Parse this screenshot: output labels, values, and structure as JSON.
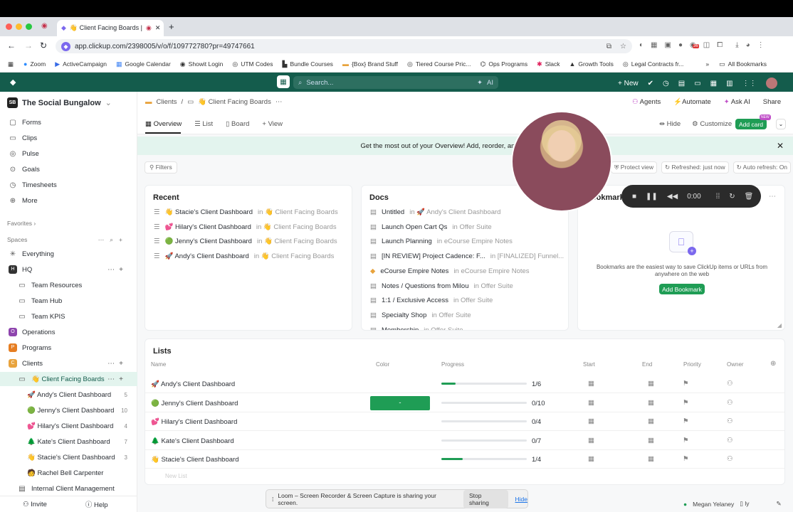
{
  "browser": {
    "tab_title": "👋 Client Facing Boards |",
    "url": "app.clickup.com/2398005/v/o/f/109772780?pr=49747661",
    "bookmarks": [
      "Zoom",
      "ActiveCampaign",
      "Google Calendar",
      "Showit Login",
      "UTM Codes",
      "Bundle Courses",
      "{Box} Brand Stuff",
      "Tiered Course Pric...",
      "Ops Programs",
      "Slack",
      "Growth Tools",
      "Legal Contracts fr..."
    ],
    "all_bookmarks": "All Bookmarks",
    "badge": "36"
  },
  "topbar": {
    "search_placeholder": "Search...",
    "ai_label": "AI",
    "new_label": "New"
  },
  "workspace": {
    "name": "The Social Bungalow",
    "initials": "SB"
  },
  "sidebar": {
    "items": [
      {
        "label": "Forms",
        "icon": "▢"
      },
      {
        "label": "Clips",
        "icon": "▭"
      },
      {
        "label": "Pulse",
        "icon": "◎"
      },
      {
        "label": "Goals",
        "icon": "⊙"
      },
      {
        "label": "Timesheets",
        "icon": "◷"
      },
      {
        "label": "More",
        "icon": "⊕"
      }
    ],
    "favorites": "Favorites",
    "spaces": "Spaces",
    "space_items": [
      {
        "label": "Everything",
        "icon": "✳",
        "indent": 0
      },
      {
        "label": "HQ",
        "icon": "H",
        "indent": 0
      },
      {
        "label": "Team Resources",
        "icon": "▭",
        "indent": 1
      },
      {
        "label": "Team Hub",
        "icon": "▭",
        "indent": 1
      },
      {
        "label": "Team KPIS",
        "icon": "▭",
        "indent": 1
      },
      {
        "label": "Operations",
        "icon": "O",
        "indent": 0
      },
      {
        "label": "Programs",
        "icon": "P",
        "indent": 0
      },
      {
        "label": "Clients",
        "icon": "C",
        "indent": 0
      },
      {
        "label": "👋 Client Facing Boards",
        "icon": "▭",
        "indent": 1
      },
      {
        "label": "🚀 Andy's Client Dashboard",
        "icon": "",
        "indent": 2,
        "count": "5"
      },
      {
        "label": "🟢 Jenny's Client Dashboard",
        "icon": "",
        "indent": 2,
        "count": "10"
      },
      {
        "label": "💕 Hilary's Client Dashboard",
        "icon": "",
        "indent": 2,
        "count": "4"
      },
      {
        "label": "🌲 Kate's Client Dashboard",
        "icon": "",
        "indent": 2,
        "count": "7"
      },
      {
        "label": "👋 Stacie's Client Dashboard",
        "icon": "",
        "indent": 2,
        "count": "3"
      },
      {
        "label": "🧑 Rachel Bell Carpenter",
        "icon": "",
        "indent": 2,
        "count": ""
      },
      {
        "label": "Internal Client Management",
        "icon": "▤",
        "indent": 1,
        "count": ""
      }
    ],
    "invite": "Invite",
    "help": "Help"
  },
  "breadcrumb": {
    "parent": "Clients",
    "current": "👋 Client Facing Boards"
  },
  "header_actions": {
    "agents": "Agents",
    "automate": "Automate",
    "ask_ai": "Ask AI",
    "share": "Share"
  },
  "view_tabs": [
    "Overview",
    "List",
    "Board",
    "+ View"
  ],
  "view_actions": {
    "hide": "Hide",
    "customize": "Customize",
    "add_card": "Add card",
    "new_badge": "NEW"
  },
  "banner": "Get the most out of your Overview! Add, reorder, and resize cards to c",
  "filters": "Filters",
  "status_chips": {
    "protect": "Protect view",
    "refreshed": "Refreshed: just now",
    "auto": "Auto refresh: On"
  },
  "recent": {
    "title": "Recent",
    "items": [
      {
        "name": "👋 Stacie's Client Dashboard",
        "loc": "in 👋 Client Facing Boards"
      },
      {
        "name": "💕 Hilary's Client Dashboard",
        "loc": "in 👋 Client Facing Boards"
      },
      {
        "name": "🟢 Jenny's Client Dashboard",
        "loc": "in 👋 Client Facing Boards"
      },
      {
        "name": "🚀 Andy's Client Dashboard",
        "loc": "in 👋 Client Facing Boards"
      }
    ]
  },
  "docs": {
    "title": "Docs",
    "items": [
      {
        "name": "Untitled",
        "loc": "in 🚀 Andy's Client Dashboard"
      },
      {
        "name": "Launch Open Cart Qs",
        "loc": "in Offer Suite"
      },
      {
        "name": "Launch Planning",
        "loc": "in eCourse Empire Notes"
      },
      {
        "name": "[IN REVIEW] Project Cadence: F...",
        "loc": "in [FINALIZED] Funnel..."
      },
      {
        "name": "eCourse Empire Notes",
        "loc": "in eCourse Empire Notes"
      },
      {
        "name": "Notes / Questions from Milou",
        "loc": "in Offer Suite"
      },
      {
        "name": "1:1 / Exclusive Access",
        "loc": "in Offer Suite"
      },
      {
        "name": "Specialty Shop",
        "loc": "in Offer Suite"
      },
      {
        "name": "Membership",
        "loc": "in Offer Suite"
      }
    ]
  },
  "bookmarks_card": {
    "title": "Bookmarks",
    "text": "Bookmarks are the easiest way to save ClickUp items or URLs from anywhere on the web",
    "button": "Add Bookmark"
  },
  "recorder": {
    "time": "0:00"
  },
  "lists": {
    "title": "Lists",
    "columns": [
      "Name",
      "Color",
      "Progress",
      "Start",
      "End",
      "Priority",
      "Owner"
    ],
    "rows": [
      {
        "name": "🚀 Andy's Client Dashboard",
        "progress": "1/6",
        "fraction": 0.1667,
        "color": ""
      },
      {
        "name": "🟢 Jenny's Client Dashboard",
        "progress": "0/10",
        "fraction": 0,
        "color": "#1f9d55"
      },
      {
        "name": "💕 Hilary's Client Dashboard",
        "progress": "0/4",
        "fraction": 0,
        "color": ""
      },
      {
        "name": "🌲 Kate's Client Dashboard",
        "progress": "0/7",
        "fraction": 0,
        "color": ""
      },
      {
        "name": "👋 Stacie's Client Dashboard",
        "progress": "1/4",
        "fraction": 0.25,
        "color": ""
      }
    ],
    "new_list": "New List"
  },
  "share_bar": {
    "text": "Loom – Screen Recorder & Screen Capture is sharing your screen.",
    "stop": "Stop sharing",
    "hide": "Hide"
  },
  "footer_user": {
    "name": "Megan Yelaney",
    "extra": "ly"
  },
  "colors": {
    "brand": "#145c4c",
    "accent": "#1f9d55",
    "banner": "#e3f4ee"
  }
}
